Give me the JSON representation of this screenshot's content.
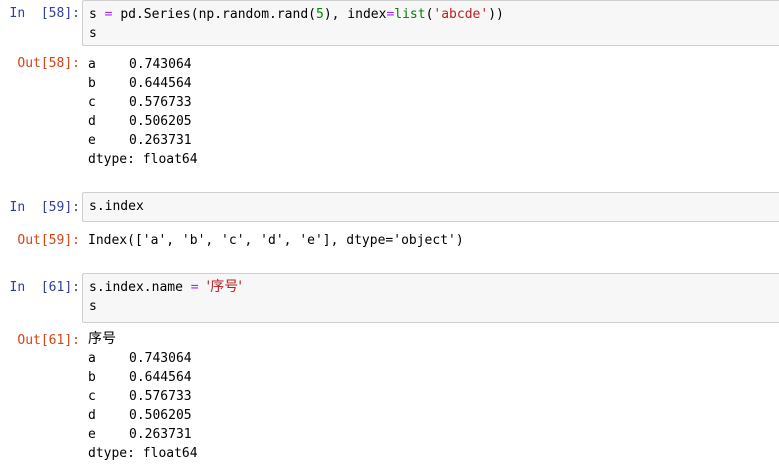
{
  "cells": [
    {
      "in_prompt": "In  [58]:",
      "out_prompt": "Out[58]:",
      "code": {
        "line1": {
          "var": "s",
          "assign": " = ",
          "call_start": "pd.Series(np.random.rand(",
          "num": "5",
          "mid": "), index",
          "eq": "=",
          "fn": "list",
          "paren_open": "(",
          "str": "'abcde'",
          "paren_close": "))"
        },
        "line2": "s"
      },
      "output": {
        "rows": [
          {
            "index": "a",
            "value": "0.743064"
          },
          {
            "index": "b",
            "value": "0.644564"
          },
          {
            "index": "c",
            "value": "0.576733"
          },
          {
            "index": "d",
            "value": "0.506205"
          },
          {
            "index": "e",
            "value": "0.263731"
          }
        ],
        "dtype": "dtype: float64"
      }
    },
    {
      "in_prompt": "In  [59]:",
      "out_prompt": "Out[59]:",
      "code": {
        "line1": "s.index"
      },
      "output": {
        "text": "Index(['a', 'b', 'c', 'd', 'e'], dtype='object')"
      }
    },
    {
      "in_prompt": "In  [61]:",
      "out_prompt": "Out[61]:",
      "code": {
        "line1": {
          "target": "s.index.name",
          "assign": " = ",
          "str": "'序号'"
        },
        "line2": "s"
      },
      "output": {
        "name": "序号",
        "rows": [
          {
            "index": "a",
            "value": "0.743064"
          },
          {
            "index": "b",
            "value": "0.644564"
          },
          {
            "index": "c",
            "value": "0.576733"
          },
          {
            "index": "d",
            "value": "0.506205"
          },
          {
            "index": "e",
            "value": "0.263731"
          }
        ],
        "dtype": "dtype: float64"
      }
    }
  ]
}
